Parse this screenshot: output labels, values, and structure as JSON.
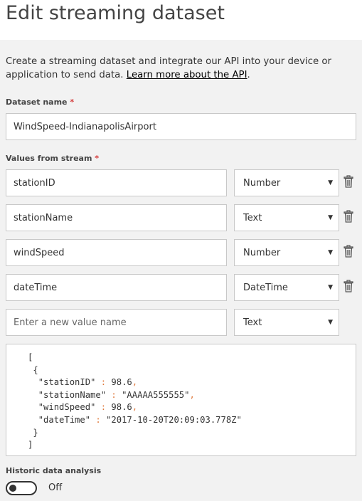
{
  "page": {
    "title": "Edit streaming dataset",
    "description_prefix": "Create a streaming dataset and integrate our API into your device or application to send data. ",
    "learn_more_link": "Learn more about the API",
    "description_suffix": "."
  },
  "dataset": {
    "label": "Dataset name",
    "required_mark": "*",
    "value": "WindSpeed-IndianapolisAirport"
  },
  "values_section": {
    "label": "Values from stream",
    "required_mark": "*",
    "rows": [
      {
        "name": "stationID",
        "type": "Number"
      },
      {
        "name": "stationName",
        "type": "Text"
      },
      {
        "name": "windSpeed",
        "type": "Number"
      },
      {
        "name": "dateTime",
        "type": "DateTime"
      }
    ],
    "new_value": {
      "placeholder": "Enter a new value name",
      "type": "Text"
    }
  },
  "json_preview": {
    "open_bracket": "[",
    "open_brace": "{",
    "lines": [
      {
        "key": "\"stationID\"",
        "sep": " : ",
        "value": "98.6",
        "comma": ","
      },
      {
        "key": "\"stationName\"",
        "sep": " : ",
        "value": "\"AAAAA555555\"",
        "comma": ","
      },
      {
        "key": "\"windSpeed\"",
        "sep": " : ",
        "value": "98.6",
        "comma": ","
      },
      {
        "key": "\"dateTime\"",
        "sep": " : ",
        "value": "\"2017-10-20T20:09:03.778Z\"",
        "comma": ""
      }
    ],
    "close_brace": "}",
    "close_bracket": "]"
  },
  "historic": {
    "label": "Historic data analysis",
    "toggle_state": "Off"
  },
  "icons": {
    "delete": "trash-icon",
    "dropdown": "chevron-down-icon"
  },
  "colors": {
    "required": "#d43b3b",
    "json_punctuation": "#e07a3d",
    "background": "#f2f2f2"
  }
}
